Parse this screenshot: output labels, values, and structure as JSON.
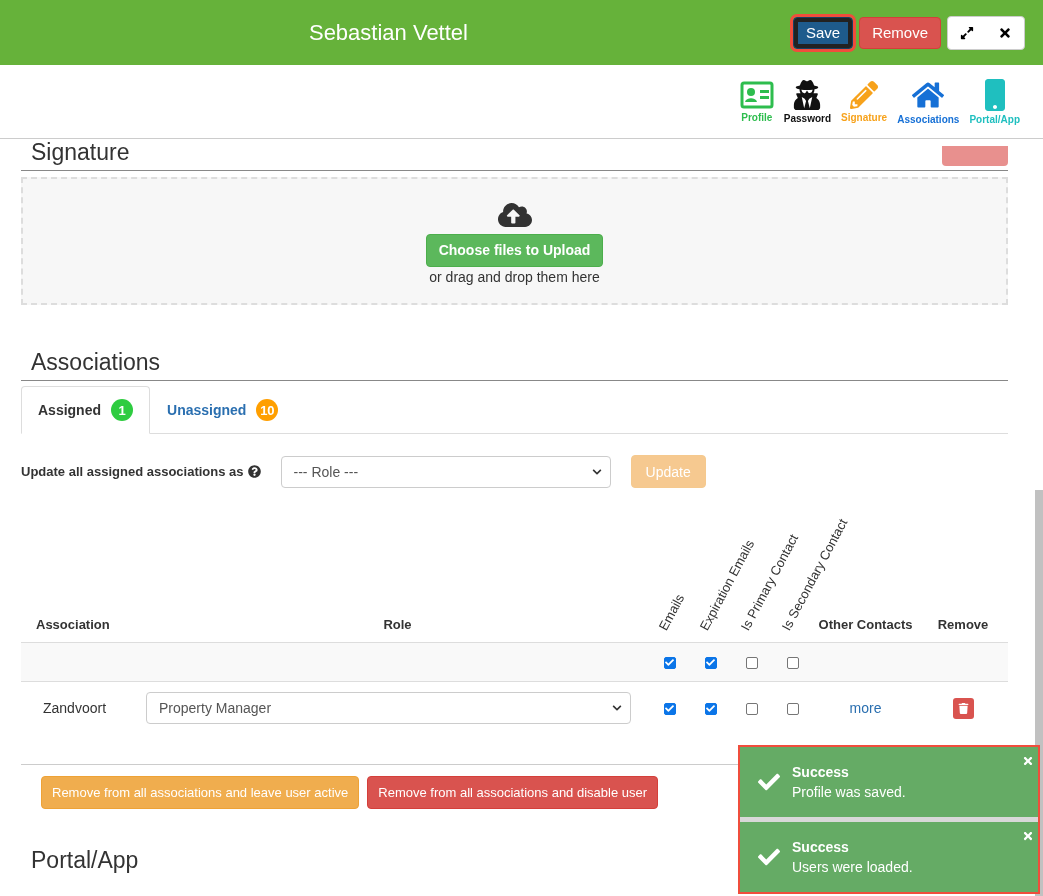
{
  "header": {
    "title": "Sebastian Vettel",
    "save": "Save",
    "remove": "Remove",
    "save_focused": true
  },
  "nav": [
    {
      "kind": "profile",
      "label": "Profile",
      "color": "#2ebd4e"
    },
    {
      "kind": "password",
      "label": "Password",
      "color": "#111111"
    },
    {
      "kind": "signature",
      "label": "Signature",
      "color": "#f7a21b"
    },
    {
      "kind": "associations",
      "label": "Associations",
      "color": "#1670d6"
    },
    {
      "kind": "portal",
      "label": "Portal/App",
      "color": "#1fbfbf"
    }
  ],
  "signature": {
    "title": "Signature",
    "upload_button": "Choose files to Upload",
    "hint": "or drag and drop them here"
  },
  "associations": {
    "title": "Associations",
    "tabs": [
      {
        "label": "Assigned",
        "count": "1",
        "selected": true,
        "color": "#2ecc40"
      },
      {
        "label": "Unassigned",
        "count": "10",
        "selected": false,
        "color": "#ff9f00"
      }
    ],
    "bulk": {
      "label": "Update all assigned associations as",
      "role_placeholder": "--- Role ---",
      "button": "Update",
      "disabled": true
    },
    "table": {
      "columns": [
        "Association",
        "Role",
        "Emails",
        "Expiration Emails",
        "Is Primary Contact",
        "Is Secondary Contact",
        "Other Contacts",
        "Remove"
      ],
      "all_row": {
        "checks": [
          true,
          true,
          false,
          false
        ]
      },
      "rows": [
        {
          "association": "Zandvoort",
          "role": "Property Manager",
          "checks": [
            true,
            true,
            false,
            false
          ],
          "other": "more"
        }
      ]
    },
    "actions": [
      "Remove from all associations and leave user active",
      "Remove from all associations and disable user"
    ]
  },
  "portal_title": "Portal/App",
  "toasts": [
    {
      "title": "Success",
      "message": "Profile was saved."
    },
    {
      "title": "Success",
      "message": "Users were loaded."
    }
  ]
}
